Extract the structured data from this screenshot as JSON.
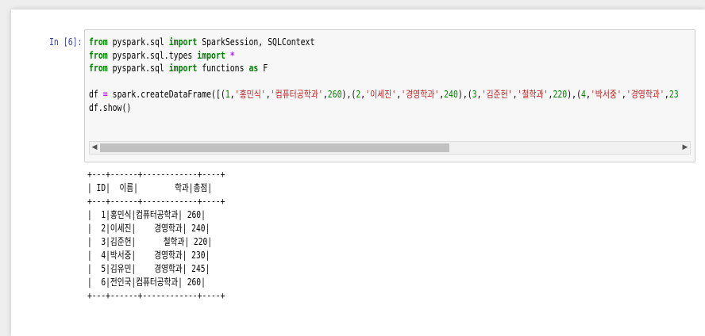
{
  "cell": {
    "prompt": "In [6]:",
    "code_lines": [
      [
        {
          "t": "from",
          "c": "kw"
        },
        {
          "t": " pyspark.sql ",
          "c": ""
        },
        {
          "t": "import",
          "c": "kw"
        },
        {
          "t": " SparkSession, SQLContext",
          "c": ""
        }
      ],
      [
        {
          "t": "from",
          "c": "kw"
        },
        {
          "t": " pyspark.sql.types ",
          "c": ""
        },
        {
          "t": "import",
          "c": "kw"
        },
        {
          "t": " ",
          "c": ""
        },
        {
          "t": "*",
          "c": "op"
        }
      ],
      [
        {
          "t": "from",
          "c": "kw"
        },
        {
          "t": " pyspark.sql ",
          "c": ""
        },
        {
          "t": "import",
          "c": "kw"
        },
        {
          "t": " functions ",
          "c": ""
        },
        {
          "t": "as",
          "c": "kw"
        },
        {
          "t": " F",
          "c": ""
        }
      ],
      [],
      [
        {
          "t": "df ",
          "c": ""
        },
        {
          "t": "=",
          "c": "op"
        },
        {
          "t": " spark.createDataFrame([(",
          "c": ""
        },
        {
          "t": "1",
          "c": "num"
        },
        {
          "t": ",",
          "c": ""
        },
        {
          "t": "'홍민식'",
          "c": "str"
        },
        {
          "t": ",",
          "c": ""
        },
        {
          "t": "'컴퓨터공학과'",
          "c": "str"
        },
        {
          "t": ",",
          "c": ""
        },
        {
          "t": "260",
          "c": "num"
        },
        {
          "t": "),(",
          "c": ""
        },
        {
          "t": "2",
          "c": "num"
        },
        {
          "t": ",",
          "c": ""
        },
        {
          "t": "'이세진'",
          "c": "str"
        },
        {
          "t": ",",
          "c": ""
        },
        {
          "t": "'경영학과'",
          "c": "str"
        },
        {
          "t": ",",
          "c": ""
        },
        {
          "t": "240",
          "c": "num"
        },
        {
          "t": "),(",
          "c": ""
        },
        {
          "t": "3",
          "c": "num"
        },
        {
          "t": ",",
          "c": ""
        },
        {
          "t": "'김준헌'",
          "c": "str"
        },
        {
          "t": ",",
          "c": ""
        },
        {
          "t": "'철학과'",
          "c": "str"
        },
        {
          "t": ",",
          "c": ""
        },
        {
          "t": "220",
          "c": "num"
        },
        {
          "t": "),(",
          "c": ""
        },
        {
          "t": "4",
          "c": "num"
        },
        {
          "t": ",",
          "c": ""
        },
        {
          "t": "'박서중'",
          "c": "str"
        },
        {
          "t": ",",
          "c": ""
        },
        {
          "t": "'경영학과'",
          "c": "str"
        },
        {
          "t": ",",
          "c": ""
        },
        {
          "t": "23",
          "c": "num"
        }
      ],
      [
        {
          "t": "df.show()",
          "c": ""
        }
      ]
    ],
    "scroll_left_arrow": "◀",
    "scroll_right_arrow": "▶",
    "output": "+---+------+------------+----+\n| ID|  이름|        학과|총점|\n+---+------+------------+----+\n|  1|홍민식|컴퓨터공학과| 260|\n|  2|이세진|    경영학과| 240|\n|  3|김준헌|      철학과| 220|\n|  4|박서중|    경영학과| 230|\n|  5|김유민|    경영학과| 245|\n|  6|전인국|컴퓨터공학과| 260|\n+---+------+------------+----+"
  },
  "colors": {
    "keyword": "#008000",
    "operator": "#aa22ff",
    "string": "#ba2121",
    "number": "#008000",
    "prompt": "#303f9f"
  }
}
